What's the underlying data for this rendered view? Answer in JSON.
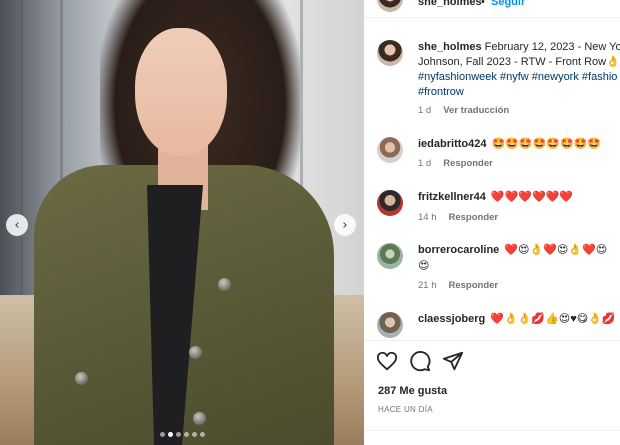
{
  "post": {
    "author": "she_holmes",
    "separator": "•",
    "follow_label": "Seguir"
  },
  "caption": {
    "author": "she_holmes",
    "line1": "February 12, 2023 - New Yo",
    "line2": "Johnson, Fall 2023 - RTW - Front Row",
    "line2_emoji": "👌",
    "hashtags_line3": [
      "#nyfashionweek",
      "#nyfw",
      "#newyork",
      "#fashio"
    ],
    "hashtags_line4": [
      "#frontrow"
    ],
    "age": "1 d",
    "translate_label": "Ver traducción"
  },
  "comments": [
    {
      "user": "iedabritto424",
      "text": "🤩🤩🤩🤩🤩🤩🤩🤩",
      "age": "1 d",
      "reply_label": "Responder"
    },
    {
      "user": "fritzkellner44",
      "text": "❤️❤️❤️❤️❤️❤️",
      "age": "14 h",
      "reply_label": "Responder"
    },
    {
      "user": "borrerocaroline",
      "text": "❤️😍👌❤️😍👌❤️😍",
      "text2": "😍",
      "age": "21 h",
      "reply_label": "Responder"
    },
    {
      "user": "claessjoberg",
      "text": "❤️👌👌💋👍😍♥😋👌💋"
    }
  ],
  "actions": {
    "like_icon": "heart-icon",
    "comment_icon": "comment-icon",
    "share_icon": "send-icon"
  },
  "stats": {
    "likes": "287 Me gusta",
    "posted": "HACE UN DÍA"
  },
  "carousel": {
    "prev": "‹",
    "next": "›",
    "slide_count": 6,
    "active_index": 1
  },
  "colors": {
    "link": "#0095f6",
    "hashtag": "#00376b",
    "muted": "#737373",
    "coat": "#5c5b38"
  }
}
